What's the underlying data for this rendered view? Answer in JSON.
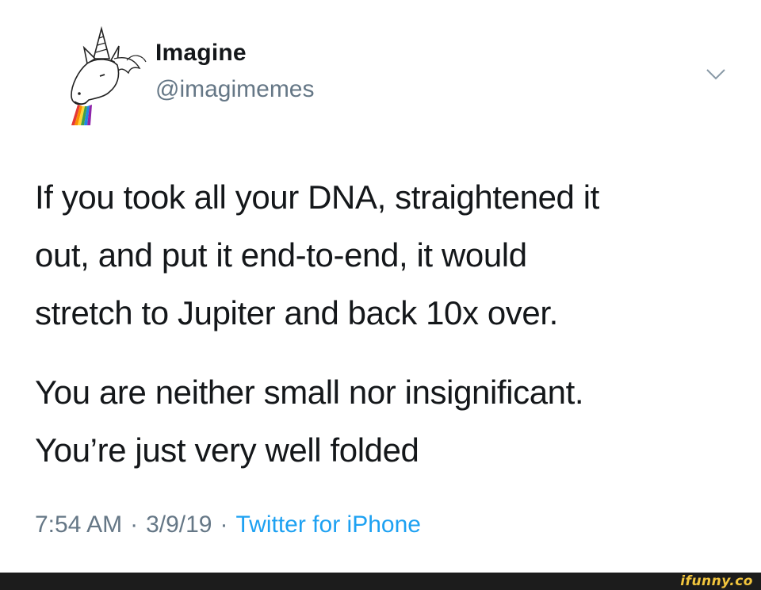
{
  "tweet": {
    "display_name": "Imagine",
    "handle": "@imagimemes",
    "avatar_icon": "unicorn-rainbow-avatar-icon",
    "menu_icon": "chevron-down-icon",
    "paragraph_1": [
      "If you took all your DNA, straightened it",
      "out, and put it end-to-end, it would",
      "stretch to Jupiter and back 10x over."
    ],
    "paragraph_2": [
      "You are neither small nor insignificant.",
      "You’re just very well folded"
    ],
    "time": "7:54 AM",
    "separator": "·",
    "date": "3/9/19",
    "source": "Twitter for iPhone",
    "colors": {
      "text": "#14171a",
      "secondary": "#657786",
      "link": "#1da1f2"
    }
  },
  "watermark": {
    "text": "ifunny.co",
    "bar_color": "#1c1c1c",
    "text_color": "#f2c53d"
  }
}
